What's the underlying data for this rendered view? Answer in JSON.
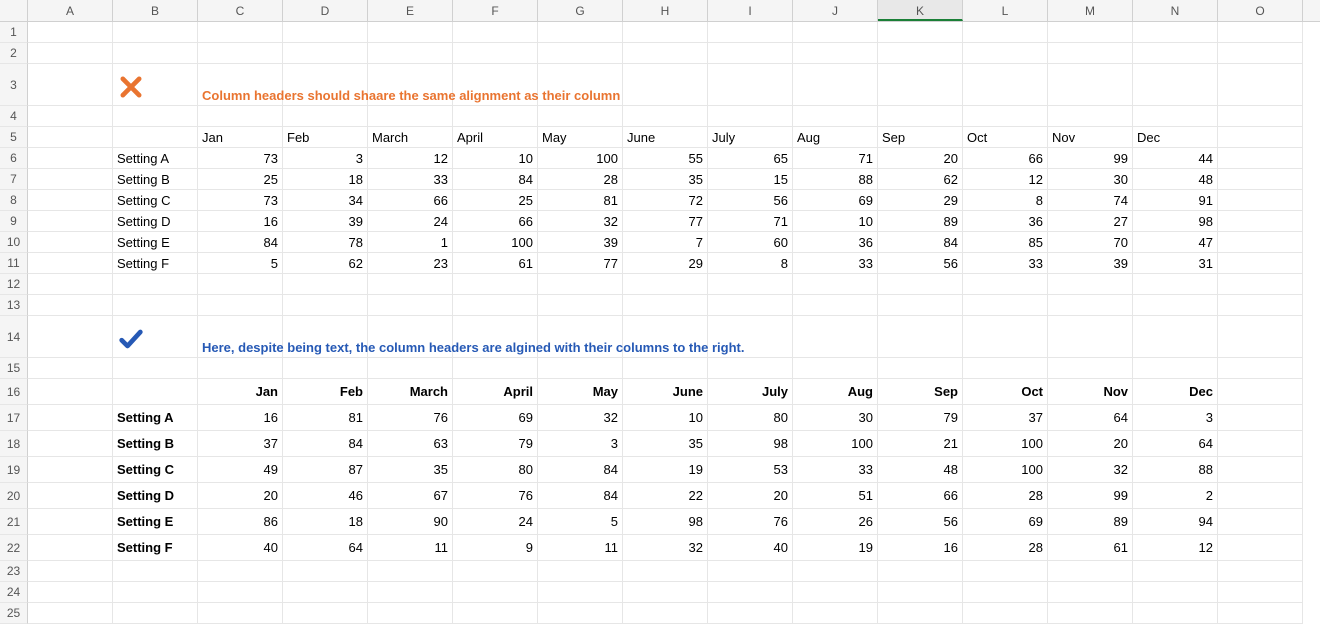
{
  "columns": [
    "A",
    "B",
    "C",
    "D",
    "E",
    "F",
    "G",
    "H",
    "I",
    "J",
    "K",
    "L",
    "M",
    "N",
    "O"
  ],
  "active_col": "K",
  "row_numbers": [
    1,
    2,
    3,
    4,
    5,
    6,
    7,
    8,
    9,
    10,
    11,
    12,
    13,
    14,
    15,
    16,
    17,
    18,
    19,
    20,
    21,
    22,
    23,
    24,
    25
  ],
  "note1": "Column headers should shaare the same alignment as their column",
  "note2": "Here, despite being text, the column headers are algined with their columns to the right.",
  "months": [
    "Jan",
    "Feb",
    "March",
    "April",
    "May",
    "June",
    "July",
    "Aug",
    "Sep",
    "Oct",
    "Nov",
    "Dec"
  ],
  "table1": {
    "row_labels": [
      "Setting A",
      "Setting B",
      "Setting C",
      "Setting D",
      "Setting E",
      "Setting F"
    ],
    "data": [
      [
        73,
        3,
        12,
        10,
        100,
        55,
        65,
        71,
        20,
        66,
        99,
        44
      ],
      [
        25,
        18,
        33,
        84,
        28,
        35,
        15,
        88,
        62,
        12,
        30,
        48
      ],
      [
        73,
        34,
        66,
        25,
        81,
        72,
        56,
        69,
        29,
        8,
        74,
        91
      ],
      [
        16,
        39,
        24,
        66,
        32,
        77,
        71,
        10,
        89,
        36,
        27,
        98
      ],
      [
        84,
        78,
        1,
        100,
        39,
        7,
        60,
        36,
        84,
        85,
        70,
        47
      ],
      [
        5,
        62,
        23,
        61,
        77,
        29,
        8,
        33,
        56,
        33,
        39,
        31
      ]
    ]
  },
  "table2": {
    "row_labels": [
      "Setting A",
      "Setting B",
      "Setting C",
      "Setting D",
      "Setting E",
      "Setting F"
    ],
    "data": [
      [
        16,
        81,
        76,
        69,
        32,
        10,
        80,
        30,
        79,
        37,
        64,
        3
      ],
      [
        37,
        84,
        63,
        79,
        3,
        35,
        98,
        100,
        21,
        100,
        20,
        64
      ],
      [
        49,
        87,
        35,
        80,
        84,
        19,
        53,
        33,
        48,
        100,
        32,
        88
      ],
      [
        20,
        46,
        67,
        76,
        84,
        22,
        20,
        51,
        66,
        28,
        99,
        2
      ],
      [
        86,
        18,
        90,
        24,
        5,
        98,
        76,
        26,
        56,
        69,
        89,
        94
      ],
      [
        40,
        64,
        11,
        9,
        11,
        32,
        40,
        19,
        16,
        28,
        61,
        12
      ]
    ]
  },
  "chart_data": [
    {
      "type": "table",
      "title": "Table 1 – headers left-aligned (incorrect)",
      "categories": [
        "Jan",
        "Feb",
        "March",
        "April",
        "May",
        "June",
        "July",
        "Aug",
        "Sep",
        "Oct",
        "Nov",
        "Dec"
      ],
      "series": [
        {
          "name": "Setting A",
          "values": [
            73,
            3,
            12,
            10,
            100,
            55,
            65,
            71,
            20,
            66,
            99,
            44
          ]
        },
        {
          "name": "Setting B",
          "values": [
            25,
            18,
            33,
            84,
            28,
            35,
            15,
            88,
            62,
            12,
            30,
            48
          ]
        },
        {
          "name": "Setting C",
          "values": [
            73,
            34,
            66,
            25,
            81,
            72,
            56,
            69,
            29,
            8,
            74,
            91
          ]
        },
        {
          "name": "Setting D",
          "values": [
            16,
            39,
            24,
            66,
            32,
            77,
            71,
            10,
            89,
            36,
            27,
            98
          ]
        },
        {
          "name": "Setting E",
          "values": [
            84,
            78,
            1,
            100,
            39,
            7,
            60,
            36,
            84,
            85,
            70,
            47
          ]
        },
        {
          "name": "Setting F",
          "values": [
            5,
            62,
            23,
            61,
            77,
            29,
            8,
            33,
            56,
            33,
            39,
            31
          ]
        }
      ]
    },
    {
      "type": "table",
      "title": "Table 2 – headers right-aligned (correct)",
      "categories": [
        "Jan",
        "Feb",
        "March",
        "April",
        "May",
        "June",
        "July",
        "Aug",
        "Sep",
        "Oct",
        "Nov",
        "Dec"
      ],
      "series": [
        {
          "name": "Setting A",
          "values": [
            16,
            81,
            76,
            69,
            32,
            10,
            80,
            30,
            79,
            37,
            64,
            3
          ]
        },
        {
          "name": "Setting B",
          "values": [
            37,
            84,
            63,
            79,
            3,
            35,
            98,
            100,
            21,
            100,
            20,
            64
          ]
        },
        {
          "name": "Setting C",
          "values": [
            49,
            87,
            35,
            80,
            84,
            19,
            53,
            33,
            48,
            100,
            32,
            88
          ]
        },
        {
          "name": "Setting D",
          "values": [
            20,
            46,
            67,
            76,
            84,
            22,
            20,
            51,
            66,
            28,
            99,
            2
          ]
        },
        {
          "name": "Setting E",
          "values": [
            86,
            18,
            90,
            24,
            5,
            98,
            76,
            26,
            56,
            69,
            89,
            94
          ]
        },
        {
          "name": "Setting F",
          "values": [
            40,
            64,
            11,
            9,
            11,
            32,
            40,
            19,
            16,
            28,
            61,
            12
          ]
        }
      ]
    }
  ]
}
